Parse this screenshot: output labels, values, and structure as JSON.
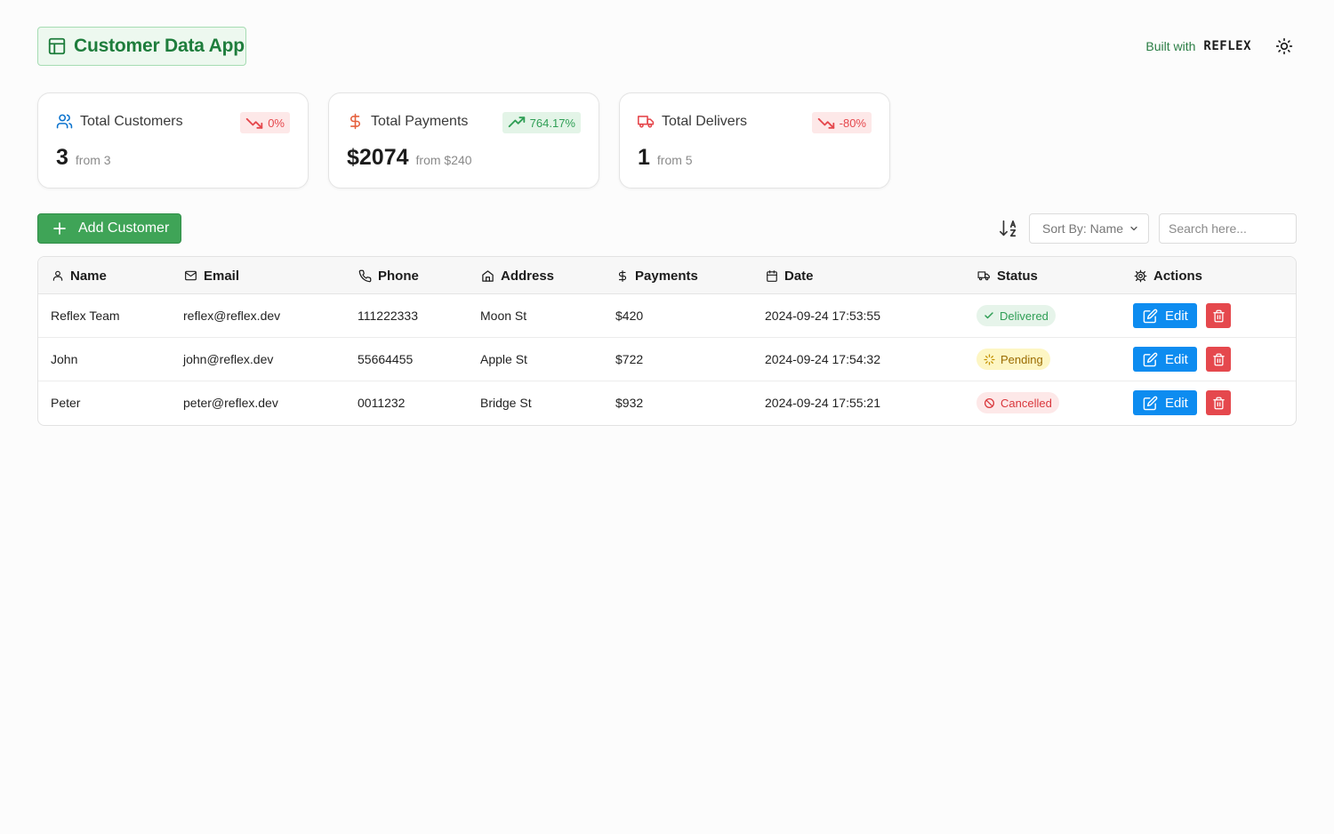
{
  "app": {
    "title": "Customer Data App"
  },
  "header": {
    "built_with": "Built with",
    "brand": "REFLEX"
  },
  "colors": {
    "brand_green": "#1e7d3c",
    "accent_green": "#3fa457",
    "edit_blue": "#0d8cf0",
    "danger_red": "#e5484d"
  },
  "stats": [
    {
      "label": "Total Customers",
      "icon": "users-icon",
      "value": "3",
      "from": "from 3",
      "change": "0%",
      "trend": "down"
    },
    {
      "label": "Total Payments",
      "icon": "dollar-icon",
      "value": "$2074",
      "from": "from $240",
      "change": "764.17%",
      "trend": "up"
    },
    {
      "label": "Total Delivers",
      "icon": "truck-icon",
      "value": "1",
      "from": "from 5",
      "change": "-80%",
      "trend": "down"
    }
  ],
  "toolbar": {
    "add_label": "Add Customer",
    "sort_label": "Sort By: Name",
    "search_placeholder": "Search here..."
  },
  "table": {
    "headers": [
      {
        "label": "Name",
        "icon": "user-icon"
      },
      {
        "label": "Email",
        "icon": "mail-icon"
      },
      {
        "label": "Phone",
        "icon": "phone-icon"
      },
      {
        "label": "Address",
        "icon": "home-icon"
      },
      {
        "label": "Payments",
        "icon": "dollar-icon"
      },
      {
        "label": "Date",
        "icon": "calendar-icon"
      },
      {
        "label": "Status",
        "icon": "truck-icon"
      },
      {
        "label": "Actions",
        "icon": "cog-icon"
      }
    ],
    "rows": [
      {
        "name": "Reflex Team",
        "email": "reflex@reflex.dev",
        "phone": "111222333",
        "address": "Moon St",
        "payments": "$420",
        "date": "2024-09-24 17:53:55",
        "status": "Delivered"
      },
      {
        "name": "John",
        "email": "john@reflex.dev",
        "phone": "55664455",
        "address": "Apple St",
        "payments": "$722",
        "date": "2024-09-24 17:54:32",
        "status": "Pending"
      },
      {
        "name": "Peter",
        "email": "peter@reflex.dev",
        "phone": "0011232",
        "address": "Bridge St",
        "payments": "$932",
        "date": "2024-09-24 17:55:21",
        "status": "Cancelled"
      }
    ],
    "edit_label": "Edit"
  }
}
